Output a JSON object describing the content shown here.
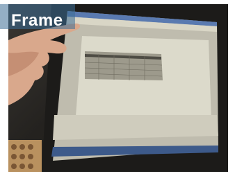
{
  "overlay": {
    "label": "Frame"
  }
}
